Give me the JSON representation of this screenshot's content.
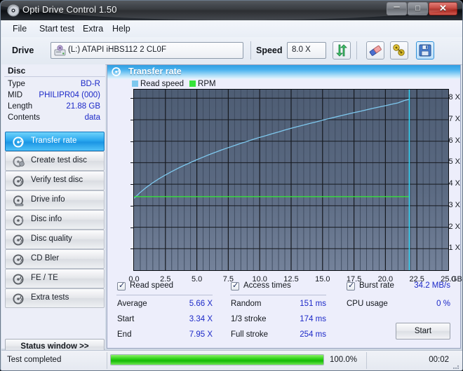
{
  "window": {
    "title": "Opti Drive Control 1.50",
    "title_icon": "disc-icon",
    "minimize_glyph": "–",
    "maximize_glyph": "□",
    "close_glyph": "✕"
  },
  "menubar": {
    "items": [
      {
        "label": "File"
      },
      {
        "label": "Start test"
      },
      {
        "label": "Extra"
      },
      {
        "label": "Help"
      }
    ]
  },
  "toolbar": {
    "drive_label": "Drive",
    "drive_icon": "drive-icon",
    "drive_value": "(L:)   ATAPI iHBS112  2 CL0F",
    "speed_label": "Speed",
    "speed_value": "8.0 X",
    "buttons": [
      {
        "name": "refresh-button",
        "icon": "refresh-icon"
      },
      {
        "name": "erase-button",
        "icon": "eraser-icon"
      },
      {
        "name": "tools-button",
        "icon": "wrench-icon"
      },
      {
        "name": "save-button",
        "icon": "floppy-save-icon"
      }
    ]
  },
  "sidebar": {
    "disc_header": "Disc",
    "disc_info": [
      {
        "key": "Type",
        "value": "BD-R"
      },
      {
        "key": "MID",
        "value": "PHILIPR04 (000)"
      },
      {
        "key": "Length",
        "value": "21.88 GB"
      },
      {
        "key": "Contents",
        "value": "data"
      }
    ],
    "tabs": [
      {
        "label": "Transfer rate",
        "icon": "disc-speed-icon",
        "active": true
      },
      {
        "label": "Create test disc",
        "icon": "disc-write-icon",
        "active": false
      },
      {
        "label": "Verify test disc",
        "icon": "disc-verify-icon",
        "active": false
      },
      {
        "label": "Drive info",
        "icon": "drive-info-icon",
        "active": false
      },
      {
        "label": "Disc info",
        "icon": "disc-info-icon",
        "active": false
      },
      {
        "label": "Disc quality",
        "icon": "disc-quality-icon",
        "active": false
      },
      {
        "label": "CD Bler",
        "icon": "disc-bler-icon",
        "active": false
      },
      {
        "label": "FE / TE",
        "icon": "disc-fete-icon",
        "active": false
      },
      {
        "label": "Extra tests",
        "icon": "disc-extra-icon",
        "active": false
      }
    ],
    "status_window_button": "Status window >>"
  },
  "panel": {
    "title": "Transfer rate",
    "title_icon": "disc-speed-icon"
  },
  "chart_data": {
    "type": "line",
    "title": "Transfer rate",
    "xlabel": "GB",
    "ylabel": "X",
    "xlim": [
      0.0,
      25.0
    ],
    "ylim": [
      0.0,
      8.4
    ],
    "grid": true,
    "legend_position": "top-left",
    "x_ticks": [
      "0.0",
      "2.5",
      "5.0",
      "7.5",
      "10.0",
      "12.5",
      "15.0",
      "17.5",
      "20.0",
      "22.5",
      "25.0"
    ],
    "x_tick_values": [
      0.0,
      2.5,
      5.0,
      7.5,
      10.0,
      12.5,
      15.0,
      17.5,
      20.0,
      22.5,
      25.0
    ],
    "x_unit": "GB",
    "y_ticks": [
      "1 X",
      "2 X",
      "3 X",
      "4 X",
      "5 X",
      "6 X",
      "7 X",
      "8 X"
    ],
    "y_tick_values": [
      1,
      2,
      3,
      4,
      5,
      6,
      7,
      8
    ],
    "legend": [
      {
        "name": "Read speed",
        "color": "#7ec8ee"
      },
      {
        "name": "RPM",
        "color": "#35e339"
      }
    ],
    "end_marker_x": 21.9,
    "end_marker_color": "#2fd4f5",
    "series": [
      {
        "name": "Read speed",
        "color": "#7ec8ee",
        "x": [
          0.0,
          0.5,
          1.0,
          1.5,
          2.0,
          2.5,
          3.0,
          3.5,
          4.0,
          4.5,
          5.0,
          5.5,
          6.0,
          6.5,
          7.0,
          7.5,
          8.0,
          8.5,
          9.0,
          9.5,
          10.0,
          10.5,
          11.0,
          11.5,
          12.0,
          12.5,
          13.0,
          13.5,
          14.0,
          14.5,
          15.0,
          15.5,
          16.0,
          16.5,
          17.0,
          17.5,
          18.0,
          18.5,
          19.0,
          19.5,
          20.0,
          20.5,
          21.0,
          21.5,
          21.9
        ],
        "y": [
          3.34,
          3.62,
          3.86,
          4.07,
          4.26,
          4.43,
          4.59,
          4.74,
          4.88,
          5.01,
          5.14,
          5.26,
          5.38,
          5.49,
          5.6,
          5.7,
          5.8,
          5.9,
          5.99,
          6.09,
          6.18,
          6.26,
          6.35,
          6.43,
          6.52,
          6.6,
          6.68,
          6.75,
          6.83,
          6.9,
          6.98,
          7.05,
          7.12,
          7.19,
          7.26,
          7.33,
          7.39,
          7.46,
          7.53,
          7.59,
          7.65,
          7.72,
          7.78,
          7.89,
          7.95
        ]
      },
      {
        "name": "RPM",
        "color": "#35e339",
        "x": [
          0.0,
          21.9
        ],
        "y": [
          3.42,
          3.42
        ]
      }
    ]
  },
  "results": {
    "read_speed": {
      "checkbox_label": "Read speed",
      "checked": true,
      "rows": [
        {
          "key": "Average",
          "value": "5.66 X"
        },
        {
          "key": "Start",
          "value": "3.34 X"
        },
        {
          "key": "End",
          "value": "7.95 X"
        }
      ]
    },
    "access_times": {
      "checkbox_label": "Access times",
      "checked": true,
      "rows": [
        {
          "key": "Random",
          "value": "151 ms"
        },
        {
          "key": "1/3 stroke",
          "value": "174 ms"
        },
        {
          "key": "Full stroke",
          "value": "254 ms"
        }
      ]
    },
    "burst": {
      "checkbox_label": "Burst rate",
      "checked": true,
      "burst_value": "34.2 MB/s",
      "rows": [
        {
          "key": "CPU usage",
          "value": "0 %"
        }
      ]
    },
    "start_button": "Start"
  },
  "statusbar": {
    "message": "Test completed",
    "progress_percent_label": "100.0%",
    "progress_percent": 100,
    "elapsed": "00:02"
  }
}
